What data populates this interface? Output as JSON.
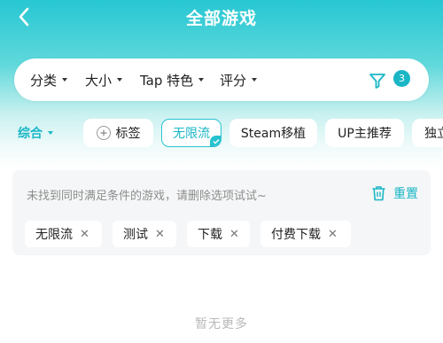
{
  "header": {
    "title": "全部游戏"
  },
  "filters": [
    {
      "label": "分类"
    },
    {
      "label": "大小"
    },
    {
      "label": "Tap 特色"
    },
    {
      "label": "评分"
    }
  ],
  "filter_count": "3",
  "sort": {
    "label": "综合"
  },
  "chips": [
    {
      "label": "标签"
    },
    {
      "label": "无限流",
      "selected": true
    },
    {
      "label": "Steam移植"
    },
    {
      "label": "UP主推荐"
    },
    {
      "label": "独立"
    }
  ],
  "notice": {
    "text": "未找到同时满足条件的游戏，请删除选项试试~",
    "reset_label": "重置"
  },
  "selected_tags": [
    {
      "label": "无限流"
    },
    {
      "label": "测试"
    },
    {
      "label": "下载"
    },
    {
      "label": "付费下载"
    }
  ],
  "footer": {
    "no_more": "暂无更多"
  },
  "colors": {
    "accent": "#19b6c6",
    "header_gradient_top": "#27c7d3",
    "panel_bg": "#f5f6f7"
  }
}
